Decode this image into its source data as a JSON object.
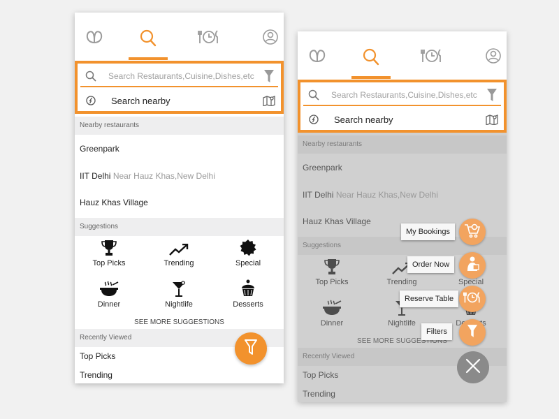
{
  "colors": {
    "accent": "#f2922d",
    "overlay": "#a0a0a0",
    "close": "#8a8a8a"
  },
  "screens": [
    {
      "tabs": [
        {
          "icon": "pretzel-icon"
        },
        {
          "icon": "search-icon",
          "active": true
        },
        {
          "icon": "meal-clock-icon"
        },
        {
          "icon": "user-icon"
        }
      ],
      "search": {
        "placeholder": "Search Restaurants,Cuisine,Dishes,etc",
        "nearby_label": "Search nearby"
      },
      "nearby": {
        "header": "Nearby restaurants",
        "items": [
          {
            "name": "Greenpark",
            "sub": ""
          },
          {
            "name": "IIT Delhi",
            "sub": "Near Hauz Khas,New Delhi"
          },
          {
            "name": "Hauz Khas Village",
            "sub": ""
          }
        ]
      },
      "suggestions": {
        "header": "Suggestions",
        "items": [
          {
            "label": "Top Picks",
            "icon": "trophy-icon"
          },
          {
            "label": "Trending",
            "icon": "trending-icon"
          },
          {
            "label": "Special",
            "icon": "special-badge-icon"
          },
          {
            "label": "Dinner",
            "icon": "dinner-bowl-icon"
          },
          {
            "label": "Nightlife",
            "icon": "cocktail-icon"
          },
          {
            "label": "Desserts",
            "icon": "cupcake-icon"
          }
        ],
        "see_more": "SEE MORE SUGGESTIONS"
      },
      "recent": {
        "header": "Recently Viewed",
        "items": [
          "Top Picks",
          "Trending"
        ]
      }
    },
    {
      "nearby": {
        "header": "Nearby restaurants",
        "items": [
          {
            "name": "Greenpark",
            "sub": ""
          },
          {
            "name": "IIT Delhi",
            "sub": "Near Hauz Khas,New Delhi"
          },
          {
            "name": "Hauz Khas Village",
            "sub": ""
          }
        ]
      },
      "suggestions": {
        "header": "Suggestions",
        "items": [
          {
            "label": "Top Picks"
          },
          {
            "label": "Trending"
          },
          {
            "label": "Special"
          },
          {
            "label": "Dinner"
          },
          {
            "label": "Nightlife"
          },
          {
            "label": "Desserts"
          }
        ],
        "see_more": "SEE MORE SUGGESTIONS"
      },
      "recent": {
        "header": "Recently Viewed",
        "items": [
          "Top Picks",
          "Trending"
        ]
      },
      "fab_menu": [
        {
          "label": "My Bookings",
          "icon": "cart-icon"
        },
        {
          "label": "Order Now",
          "icon": "delivery-icon"
        },
        {
          "label": "Reserve Table",
          "icon": "meal-clock-icon"
        },
        {
          "label": "Filters",
          "icon": "filter-icon"
        }
      ]
    }
  ]
}
